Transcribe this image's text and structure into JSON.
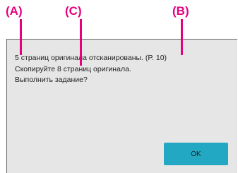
{
  "callouts": {
    "a": "(A)",
    "c": "(C)",
    "b": "(B)"
  },
  "dialog": {
    "lines": [
      "5 страниц оригинала отсканированы. (P. 10)",
      "Скопируйте 8 страниц оригинала.",
      "Выполнить задание?"
    ],
    "ok_label": "OK"
  },
  "colors": {
    "callout": "#e6007e",
    "dialog_bg": "#e6e6e6",
    "ok_button": "#23a8c4"
  }
}
